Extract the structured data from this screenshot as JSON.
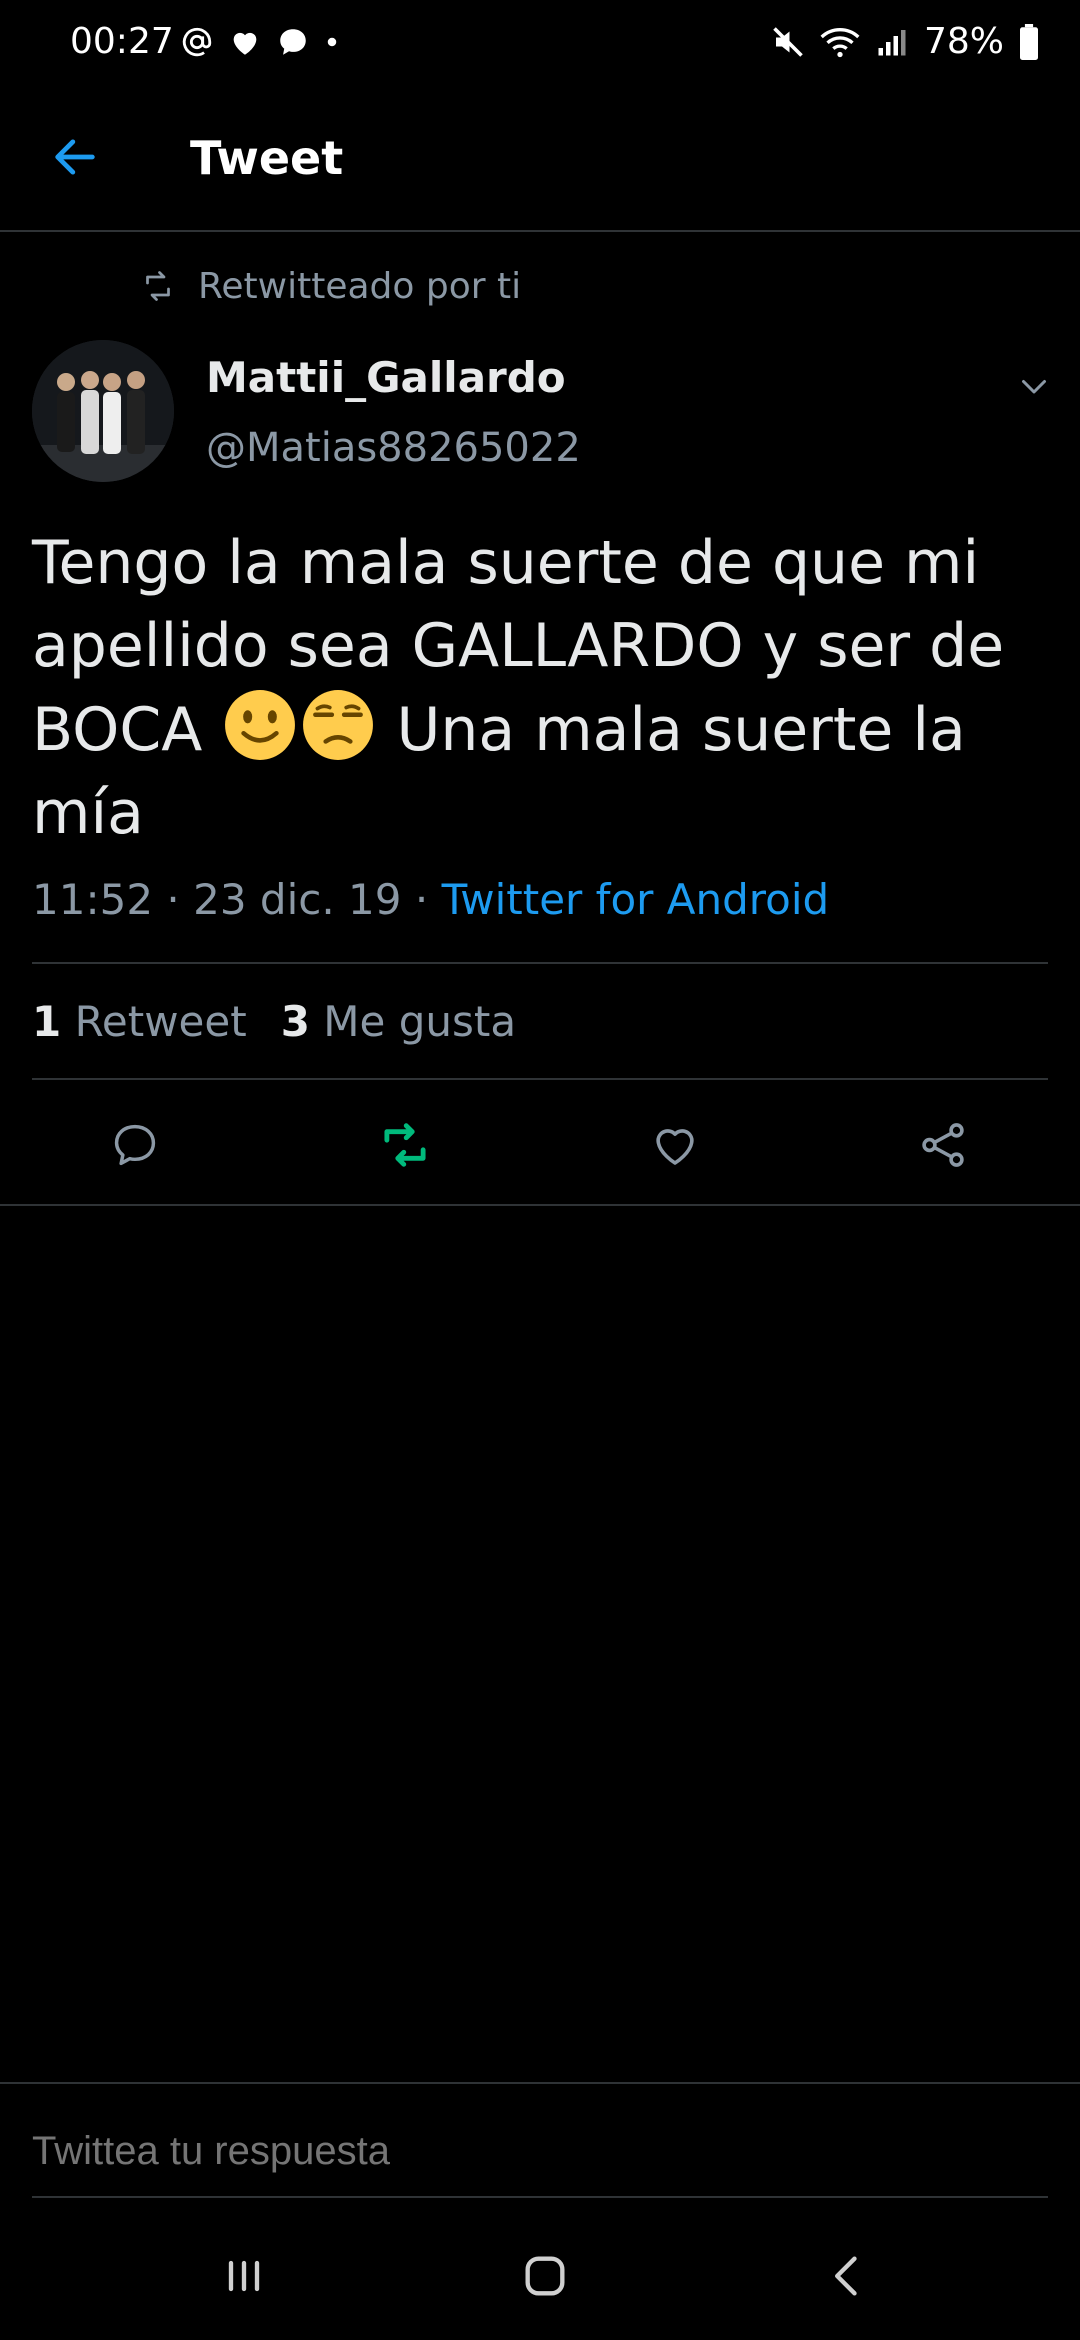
{
  "status_bar": {
    "time": "00:27",
    "battery": "78%",
    "icons": [
      "at-icon",
      "heart-icon",
      "chat-bubble-icon",
      "dot-icon",
      "mute-icon",
      "wifi-icon",
      "signal-icon",
      "battery-icon"
    ]
  },
  "header": {
    "title": "Tweet"
  },
  "tweet": {
    "retweet_context": "Retwitteado por ti",
    "author_name": "Mattii_Gallardo",
    "author_handle": "@Matias88265022",
    "text_part1": "Tengo la mala suerte de que mi apellido sea GALLARDO y ser de BOCA",
    "text_part2": "Una mala suerte la mía",
    "emojis": [
      "slightly-smiling-face",
      "unamused-face"
    ],
    "time": "11:52",
    "separator": "·",
    "date": "23 dic. 19",
    "source": "Twitter for Android",
    "retweets_count": "1",
    "retweets_label": "Retweet",
    "likes_count": "3",
    "likes_label": "Me gusta"
  },
  "actions": [
    "reply-icon",
    "retweet-icon",
    "like-icon",
    "share-icon"
  ],
  "reply_bar": {
    "placeholder": "Twittea tu respuesta"
  },
  "colors": {
    "background": "#000000",
    "accent": "#1d9bf0",
    "retweet_active": "#00ba7c",
    "secondary_text": "#8b98a5",
    "divider": "#2f3336"
  }
}
